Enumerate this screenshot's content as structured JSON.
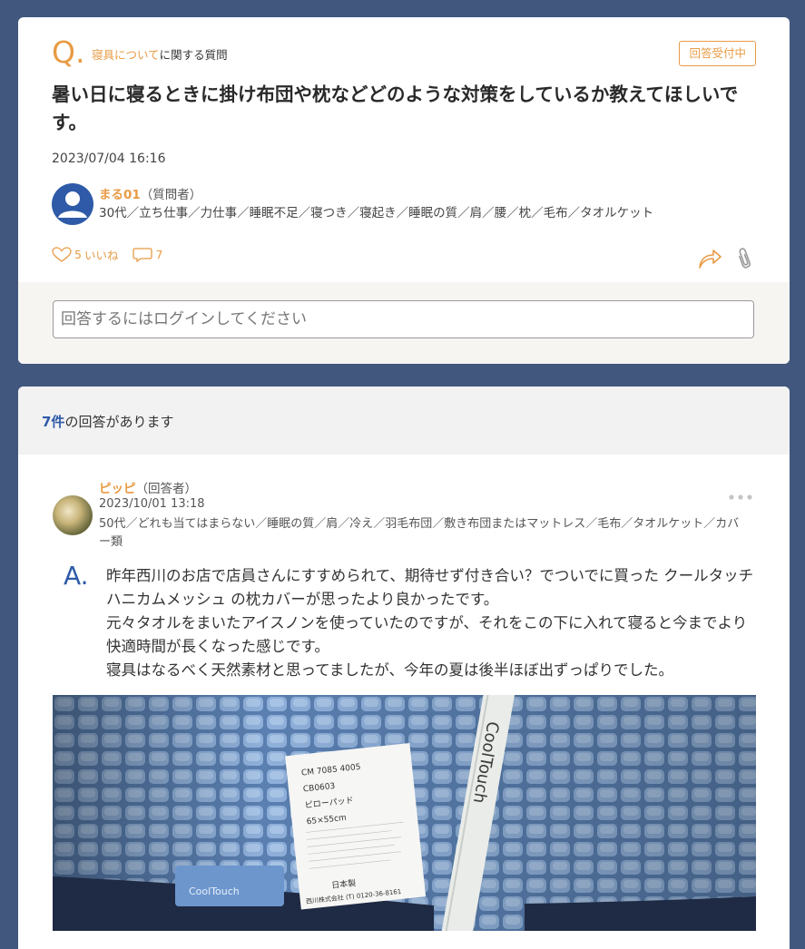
{
  "question": {
    "mark": "Q.",
    "category_link": "寝具について",
    "category_suffix": "に関する質問",
    "status": "回答受付中",
    "title": "暑い日に寝るときに掛け布団や枕などどのような対策をしているか教えてほしいです。",
    "date": "2023/07/04 16:16",
    "user": {
      "name": "まる01",
      "role": "（質問者）"
    },
    "tags": "30代／立ち仕事／力仕事／睡眠不足／寝つき／寝起き／睡眠の質／肩／腰／枕／毛布／タオルケット",
    "likes": "5",
    "likes_label": "いいね",
    "comments": "7",
    "login_placeholder": "回答するにはログインしてください"
  },
  "answers": {
    "count": "7件",
    "count_suffix": "の回答があります",
    "items": [
      {
        "user": {
          "name": "ピッピ",
          "role": "（回答者）"
        },
        "date": "2023/10/01 13:18",
        "tags": "50代／どれも当てはまらない／睡眠の質／肩／冷え／羽毛布団／敷き布団またはマットレス／毛布／タオルケット／カバー類",
        "mark": "A.",
        "body": [
          "昨年西川のお店で店員さんにすすめられて、期待せず付き合い？でついでに買った クールタッチ ハニカムメッシュ の枕カバーが思ったより良かったです。",
          "元々タオルをまいたアイスノンを使っていたのですが、それをこの下に入れて寝ると今までより快適時間が長くなった感じです。",
          "寝具はなるべく天然素材と思ってましたが、今年の夏は後半ほぼ出ずっぱりでした。"
        ],
        "photo": {
          "label_lines": [
            "CM 7085 4005",
            "CB0603",
            "ピローパッド",
            "65×55cm",
            "日本製",
            "西川株式会社 (T) 0120-36-8161"
          ],
          "tag_text": "CoolTouch",
          "band_text": "CoolTouch"
        }
      }
    ]
  },
  "colors": {
    "background": "#41577e",
    "accent": "#e89b45",
    "blue": "#2e5aa8"
  },
  "icons": [
    "heart-icon",
    "comment-icon",
    "share-icon",
    "paperclip-icon",
    "more-icon",
    "user-icon"
  ]
}
